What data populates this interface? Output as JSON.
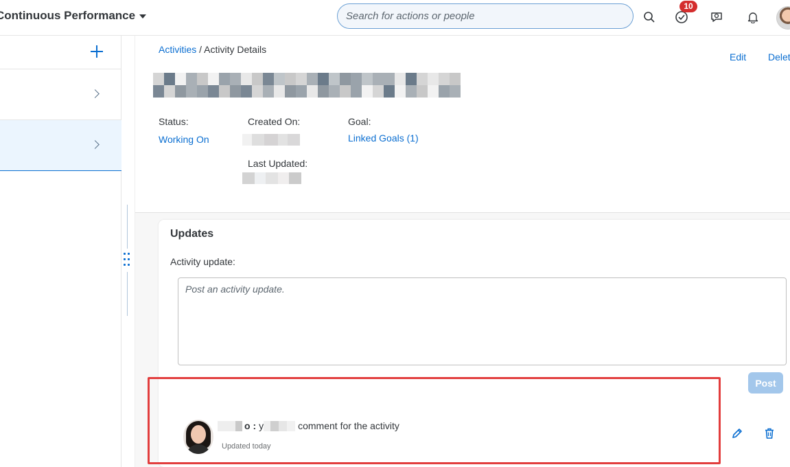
{
  "shell": {
    "app_title": "Continuous Performance",
    "search_placeholder": "Search for actions or people",
    "todo_badge": "10",
    "icons": [
      "search-icon",
      "todo-icon",
      "assistant-icon",
      "bell-icon"
    ]
  },
  "breadcrumb": {
    "root": "Activities",
    "separator": " / ",
    "current": "Activity Details"
  },
  "header_actions": {
    "edit": "Edit",
    "delete": "Delet"
  },
  "attributes": {
    "status_label": "Status:",
    "status_value": "Working On",
    "created_label": "Created On:",
    "updated_label": "Last Updated:",
    "goal_label": "Goal:",
    "goal_value": "Linked Goals (1)"
  },
  "updates": {
    "title": "Updates",
    "field_label": "Activity update:",
    "placeholder": "Post an activity update.",
    "post_label": "Post"
  },
  "comment": {
    "author_suffix": "o :",
    "text_prefix": "y",
    "text": "comment for the activity",
    "meta": "Updated today"
  },
  "colors": {
    "accent": "#0a6ed1",
    "badge": "#d42d2d",
    "highlight": "#e23d3d"
  }
}
